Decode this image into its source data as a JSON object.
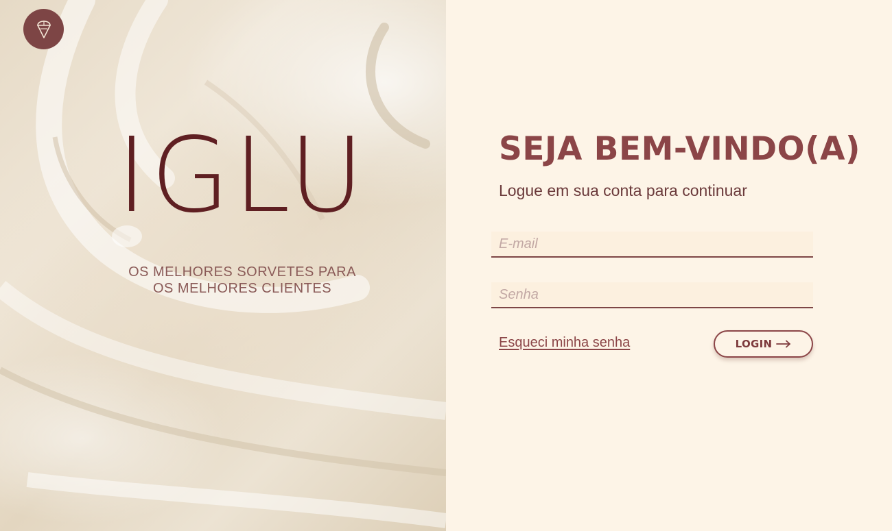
{
  "brand": {
    "name": "IGLU",
    "tagline_line1": "OS MELHORES SORVETES PARA",
    "tagline_line2": "OS MELHORES CLIENTES",
    "logo_icon": "ice-cream-icon"
  },
  "login": {
    "title": "SEJA BEM-VINDO(A)",
    "subtitle": "Logue em sua conta para continuar",
    "email_placeholder": "E-mail",
    "email_value": "",
    "password_placeholder": "Senha",
    "password_value": "",
    "forgot_label": "Esqueci minha senha",
    "submit_label": "LOGIN",
    "submit_icon": "arrow-right-icon"
  },
  "colors": {
    "accent": "#8b4547",
    "brand_dark": "#5f1f22",
    "panel_background": "#fdf4e7",
    "logo_badge": "#7d4545"
  }
}
